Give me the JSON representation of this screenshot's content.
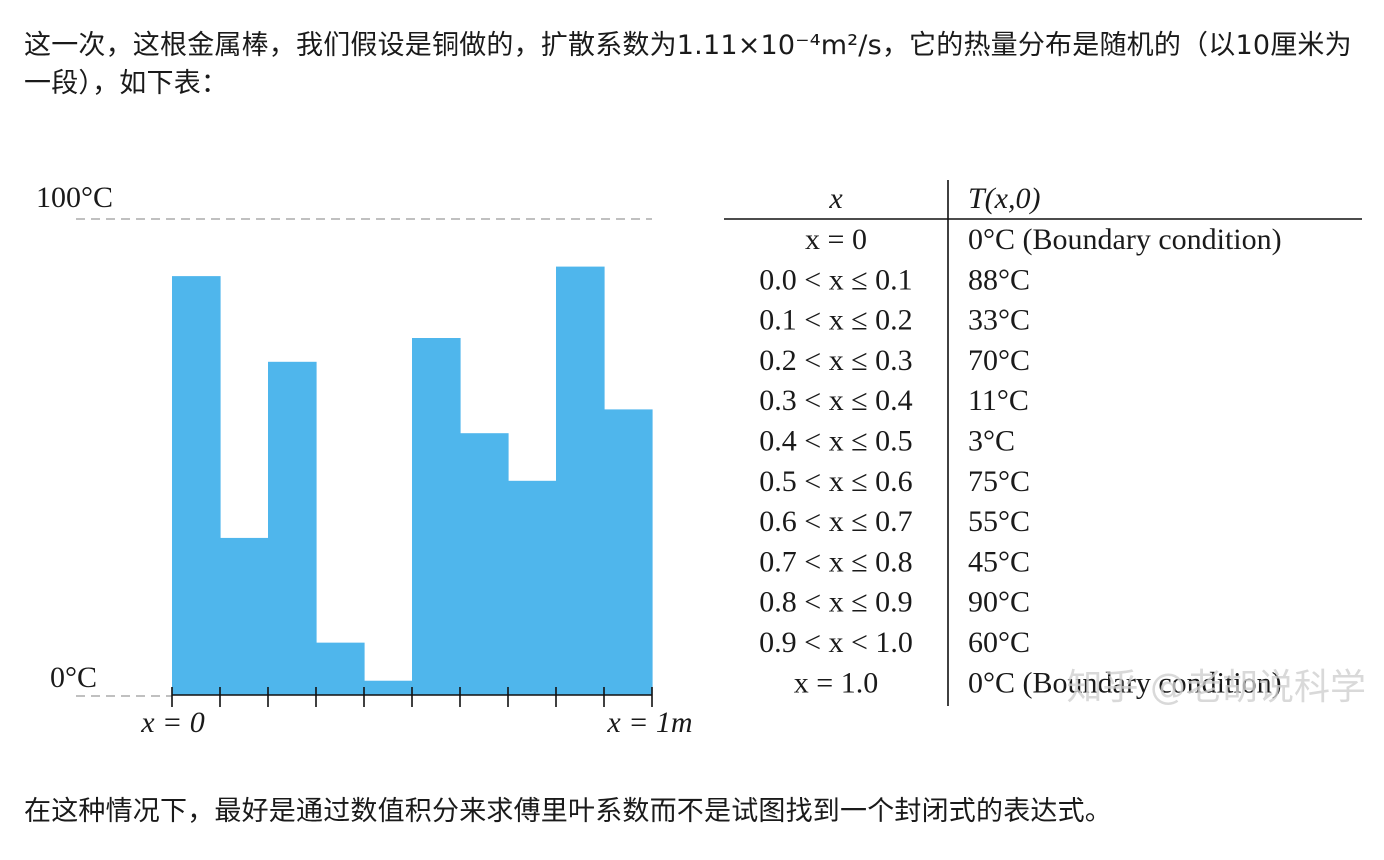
{
  "intro_text": "这一次，这根金属棒，我们假设是铜做的，扩散系数为1.11×10⁻⁴m²/s，它的热量分布是随机的（以10厘米为一段），如下表：",
  "closing_text": "在这种情况下，最好是通过数值积分来求傅里叶系数而不是试图找到一个封闭式的表达式。",
  "watermark": "知乎 @老胡说科学",
  "colors": {
    "bar": "#4fb6ec",
    "text": "#1a1a1a"
  },
  "chart_data": {
    "type": "bar",
    "title": "",
    "xlabel": "",
    "ylabel": "",
    "ylim": [
      0,
      100
    ],
    "y_labels": [
      "100°C",
      "0°C"
    ],
    "x_labels": [
      "x = 0",
      "x = 1m"
    ],
    "categories": [
      "0.0–0.1",
      "0.1–0.2",
      "0.2–0.3",
      "0.3–0.4",
      "0.4–0.5",
      "0.5–0.6",
      "0.6–0.7",
      "0.7–0.8",
      "0.8–0.9",
      "0.9–1.0"
    ],
    "values": [
      88,
      33,
      70,
      11,
      3,
      75,
      55,
      45,
      90,
      60
    ]
  },
  "table": {
    "headers": [
      "x",
      "T(x,0)"
    ],
    "rows": [
      [
        "x = 0",
        "0°C (Boundary condition)"
      ],
      [
        "0.0 < x ≤ 0.1",
        "88°C"
      ],
      [
        "0.1 < x ≤ 0.2",
        "33°C"
      ],
      [
        "0.2 < x ≤ 0.3",
        "70°C"
      ],
      [
        "0.3 < x ≤ 0.4",
        "11°C"
      ],
      [
        "0.4 < x ≤ 0.5",
        "3°C"
      ],
      [
        "0.5 < x ≤ 0.6",
        "75°C"
      ],
      [
        "0.6 < x ≤ 0.7",
        "55°C"
      ],
      [
        "0.7 < x ≤ 0.8",
        "45°C"
      ],
      [
        "0.8 < x ≤ 0.9",
        "90°C"
      ],
      [
        "0.9 < x < 1.0",
        "60°C"
      ],
      [
        "x = 1.0",
        "0°C (Boundary condition)"
      ]
    ]
  }
}
